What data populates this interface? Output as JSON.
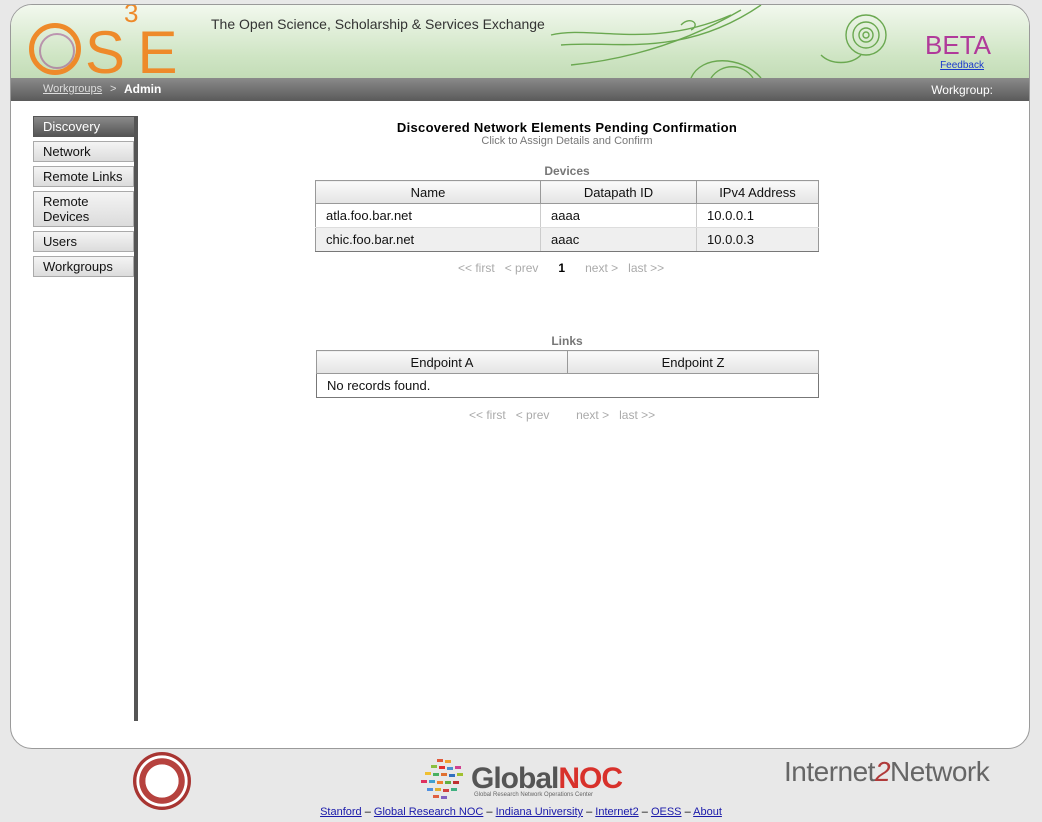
{
  "header": {
    "logo_text": "S",
    "logo_sup": "3",
    "logo_e": "E",
    "tagline": "The Open Science, Scholarship & Services Exchange",
    "beta": "BETA",
    "feedback": "Feedback"
  },
  "navbar": {
    "crumb_link": "Workgroups",
    "crumb_sep": ">",
    "crumb_current": "Admin",
    "workgroup_label": "Workgroup:"
  },
  "sidebar": {
    "items": [
      {
        "label": "Discovery"
      },
      {
        "label": "Network"
      },
      {
        "label": "Remote Links"
      },
      {
        "label": "Remote Devices"
      },
      {
        "label": "Users"
      },
      {
        "label": "Workgroups"
      }
    ]
  },
  "main": {
    "title": "Discovered Network Elements Pending Confirmation",
    "subtitle": "Click to Assign Details and Confirm",
    "devices": {
      "label": "Devices",
      "columns": [
        "Name",
        "Datapath ID",
        "IPv4 Address"
      ],
      "rows": [
        [
          "atla.foo.bar.net",
          "aaaa",
          "10.0.0.1"
        ],
        [
          "chic.foo.bar.net",
          "aaac",
          "10.0.0.3"
        ]
      ],
      "pager": {
        "first": "<< first",
        "prev": "< prev",
        "page": "1",
        "next": "next >",
        "last": "last >>"
      }
    },
    "links": {
      "label": "Links",
      "columns": [
        "Endpoint A",
        "Endpoint Z"
      ],
      "empty": "No records found.",
      "pager": {
        "first": "<< first",
        "prev": "< prev",
        "next": "next >",
        "last": "last >>"
      }
    }
  },
  "footer": {
    "globalnoc_a": "Global",
    "globalnoc_b": "NOC",
    "globalnoc_sub": "Global Research Network Operations Center",
    "internet2_a": "Internet",
    "internet2_b": "2",
    "internet2_c": "Network",
    "links": [
      "Stanford",
      "Global Research NOC",
      "Indiana University",
      "Internet2",
      "OESS",
      "About"
    ],
    "sep": "–"
  }
}
